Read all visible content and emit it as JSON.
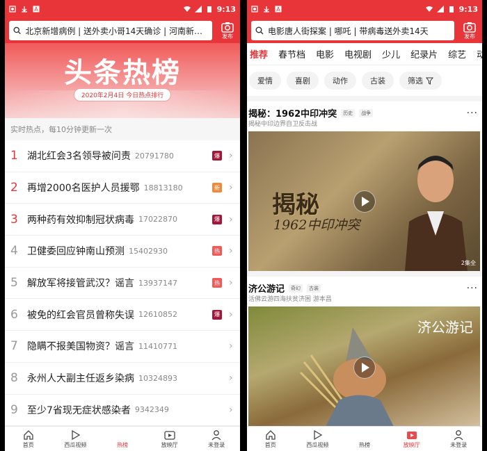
{
  "left": {
    "status": {
      "time": "9:13"
    },
    "search": {
      "text": "北京新增病例 | 送外卖小哥14天确诊 | 河南新增确..."
    },
    "publish_label": "发布",
    "banner": {
      "title": "头条热榜",
      "date": "2020年2月4日  今日热点排行"
    },
    "subhead": "实时热点，每10分钟更新一次",
    "items": [
      {
        "rank": "1",
        "title": "湖北红会3名领导被问责",
        "count": "20791780",
        "badge": "爆",
        "badge_color": "#a3183a"
      },
      {
        "rank": "2",
        "title": "再增2000名医护人员援鄂",
        "count": "18813180",
        "badge": "新",
        "badge_color": "#f08a3a"
      },
      {
        "rank": "3",
        "title": "两种药有效抑制冠状病毒",
        "count": "17022870",
        "badge": "爆",
        "badge_color": "#a3183a"
      },
      {
        "rank": "4",
        "title": "卫健委回应钟南山预测",
        "count": "15402930",
        "badge": "热",
        "badge_color": "#f05a5a"
      },
      {
        "rank": "5",
        "title": "解放军将接管武汉？谣言",
        "count": "13937147",
        "badge": "热",
        "badge_color": "#f05a5a"
      },
      {
        "rank": "6",
        "title": "被免的红会官员曾称失误",
        "count": "12610852",
        "badge": "爆",
        "badge_color": "#a3183a"
      },
      {
        "rank": "7",
        "title": "隐瞒不报美国物资？谣言",
        "count": "11410771",
        "badge": "",
        "badge_color": ""
      },
      {
        "rank": "8",
        "title": "永州人大副主任返乡染病",
        "count": "10324893",
        "badge": "",
        "badge_color": ""
      },
      {
        "rank": "9",
        "title": "至少7省现无症状感染者",
        "count": "9342349",
        "badge": "",
        "badge_color": ""
      }
    ],
    "nav": [
      "首页",
      "西瓜视频",
      "热榜",
      "放映厅",
      "未登录"
    ],
    "nav_active": 2
  },
  "right": {
    "status": {
      "time": "9:13"
    },
    "search": {
      "text": "电影唐人街探案 | 哪吒 | 带病毒送外卖14天"
    },
    "publish_label": "发布",
    "tabs": [
      "推荐",
      "春节档",
      "电影",
      "电视剧",
      "少儿",
      "纪录片",
      "综艺",
      "动漫"
    ],
    "filters": [
      "爱情",
      "喜剧",
      "动作",
      "古装",
      "筛选"
    ],
    "cards": [
      {
        "title": "揭秘：1962中印冲突",
        "tags": [
          "历史",
          "战争"
        ],
        "sub": "揭秘中印边界自卫反击战",
        "episode": "2集全",
        "video_title": "揭秘",
        "video_sub": "1962中印冲突"
      },
      {
        "title": "济公游记",
        "tags": [
          "奇幻",
          "古装"
        ],
        "sub": "活佛云游四海扶贫济困    游本昌",
        "episode": "",
        "video_title": "济公游记",
        "video_sub": ""
      }
    ],
    "nav": [
      "首页",
      "西瓜视频",
      "热榜",
      "放映厅",
      "未登录"
    ],
    "nav_active": 3
  },
  "colors": {
    "accent": "#e8353a"
  }
}
